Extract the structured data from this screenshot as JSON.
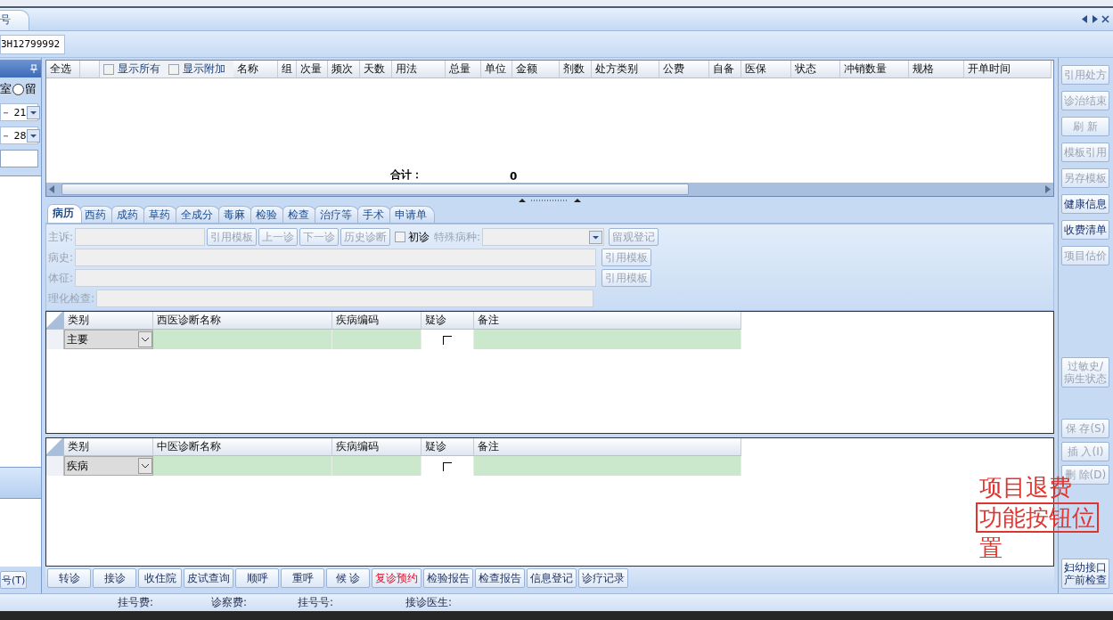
{
  "window_tabs": [
    {
      "label": "号",
      "selected": true
    }
  ],
  "toolbar": {
    "patient_field": "3H12799992"
  },
  "left_panel": {
    "label_fragment": "室",
    "radio": {
      "label": "留",
      "selected": false
    },
    "dates": [
      "－ 21",
      "－ 28"
    ],
    "button": "号(T)"
  },
  "drug_grid": {
    "select_all": "全选",
    "checks": [
      {
        "label": "显示所有",
        "checked": false
      },
      {
        "label": "显示附加",
        "checked": false
      }
    ],
    "columns": [
      "名称",
      "组",
      "次量",
      "频次",
      "天数",
      "用法",
      "总量",
      "单位",
      "金额",
      "剂数",
      "处方类别",
      "公费",
      "自备",
      "医保",
      "状态",
      "冲销数量",
      "规格",
      "开单时间"
    ],
    "total_label": "合计：",
    "total_value": "0"
  },
  "record_tabs": [
    {
      "label": "病历",
      "selected": true
    },
    {
      "label": "西药",
      "selected": false
    },
    {
      "label": "成药",
      "selected": false
    },
    {
      "label": "草药",
      "selected": false
    },
    {
      "label": "全成分",
      "selected": false
    },
    {
      "label": "毒麻",
      "selected": false
    },
    {
      "label": "检验",
      "selected": false
    },
    {
      "label": "检查",
      "selected": false
    },
    {
      "label": "治疗等",
      "selected": false
    },
    {
      "label": "手术",
      "selected": false
    },
    {
      "label": "申请单",
      "selected": false
    }
  ],
  "form": {
    "complaint_label": "主诉:",
    "complaint_buttons": [
      "引用模板",
      "上一诊",
      "下一诊",
      "历史诊断"
    ],
    "first_visit": {
      "label": "初诊",
      "checked": false
    },
    "special_label": "特殊病种:",
    "observe_button": "留观登记",
    "history_label": "病史:",
    "history_button": "引用模板",
    "signs_label": "体征:",
    "signs_button": "引用模板",
    "lab_label": "理化检查:"
  },
  "diagnosis_grids": [
    {
      "columns": [
        "类别",
        "西医诊断名称",
        "疾病编码",
        "疑诊",
        "备注"
      ],
      "category": "主要",
      "suspected": false
    },
    {
      "columns": [
        "类别",
        "中医诊断名称",
        "疾病编码",
        "疑诊",
        "备注"
      ],
      "category": "疾病",
      "suspected": false
    }
  ],
  "bottom_buttons": [
    {
      "label": "转诊",
      "alert": false
    },
    {
      "label": "接诊",
      "alert": false
    },
    {
      "label": "收住院",
      "alert": false
    },
    {
      "label": "皮试查询",
      "alert": false
    },
    {
      "label": "顺呼",
      "alert": false
    },
    {
      "label": "重呼",
      "alert": false
    },
    {
      "label": "候 诊",
      "alert": false
    },
    {
      "label": "复诊预约",
      "alert": true
    },
    {
      "label": "检验报告",
      "alert": false
    },
    {
      "label": "检查报告",
      "alert": false
    },
    {
      "label": "信息登记",
      "alert": false
    },
    {
      "label": "诊疗记录",
      "alert": false
    }
  ],
  "side_buttons": [
    {
      "label": "引用处方",
      "disabled": true,
      "kind": "top"
    },
    {
      "label": "诊治结束",
      "disabled": true,
      "kind": "top"
    },
    {
      "label": "刷 新",
      "disabled": true,
      "kind": "top"
    },
    {
      "label": "模板引用",
      "disabled": true,
      "kind": "top"
    },
    {
      "label": "另存模板",
      "disabled": true,
      "kind": "top"
    },
    {
      "label": "健康信息",
      "disabled": false,
      "kind": "top"
    },
    {
      "label": "收费清单",
      "disabled": false,
      "kind": "top"
    },
    {
      "label": "项目估价",
      "disabled": true,
      "kind": "top"
    },
    {
      "label": "过敏史/病生状态",
      "disabled": true,
      "kind": "middle"
    },
    {
      "label": "保 存(S)",
      "disabled": true,
      "kind": "lower"
    },
    {
      "label": "插 入(I)",
      "disabled": true,
      "kind": "lower"
    },
    {
      "label": "删 除(D)",
      "disabled": true,
      "kind": "lower"
    },
    {
      "label": "妇幼接口产前检查",
      "disabled": false,
      "kind": "bottom"
    }
  ],
  "status_bar": [
    "挂号费:",
    "诊察费:",
    "挂号号:",
    "接诊医生:"
  ],
  "annotation": {
    "lines": [
      "项目退费",
      "功能按钮位",
      "置"
    ]
  }
}
